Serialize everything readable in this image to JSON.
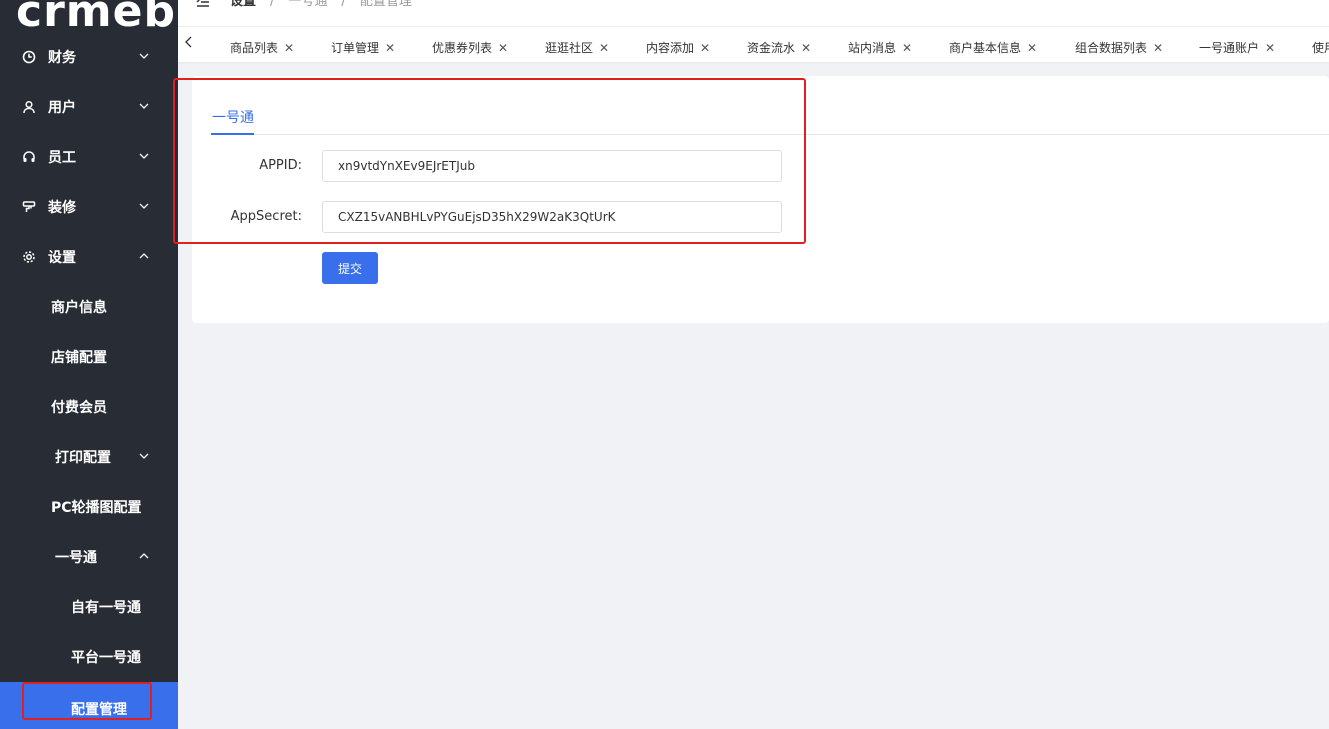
{
  "sidebar": {
    "logo": "crmeb",
    "menus": [
      {
        "label": "财务",
        "icon": "clock-icon",
        "expanded": false
      },
      {
        "label": "用户",
        "icon": "user-icon",
        "expanded": false
      },
      {
        "label": "员工",
        "icon": "headset-icon",
        "expanded": false
      },
      {
        "label": "装修",
        "icon": "paint-roller-icon",
        "expanded": false
      },
      {
        "label": "设置",
        "icon": "gear-icon",
        "expanded": true
      }
    ],
    "settings_items": [
      {
        "label": "商户信息"
      },
      {
        "label": "店铺配置"
      },
      {
        "label": "付费会员"
      },
      {
        "label": "打印配置",
        "has_children": true,
        "expanded": false
      },
      {
        "label": "PC轮播图配置"
      },
      {
        "label": "一号通",
        "has_children": true,
        "expanded": true
      }
    ],
    "yihaotong_items": [
      {
        "label": "自有一号通"
      },
      {
        "label": "平台一号通"
      },
      {
        "label": "配置管理",
        "active": true
      }
    ]
  },
  "header": {
    "breadcrumb": [
      "设置",
      "/",
      "一号通",
      "/",
      "配置管理"
    ]
  },
  "tabs": [
    "商品列表",
    "订单管理",
    "优惠券列表",
    "逛逛社区",
    "内容添加",
    "资金流水",
    "站内消息",
    "商户基本信息",
    "组合数据列表",
    "一号通账户",
    "使用"
  ],
  "card": {
    "tab_label": "一号通",
    "appid_label": "APPID:",
    "appid_value": "xn9vtdYnXEv9EJrETJub",
    "appsecret_label": "AppSecret:",
    "appsecret_value": "CXZ15vANBHLvPYGuEjsD35hX29W2aK3QtUrK",
    "submit_label": "提交"
  },
  "colors": {
    "sidebar_bg": "#282c34",
    "accent": "#3a6fec",
    "highlight_box": "#e02020"
  }
}
